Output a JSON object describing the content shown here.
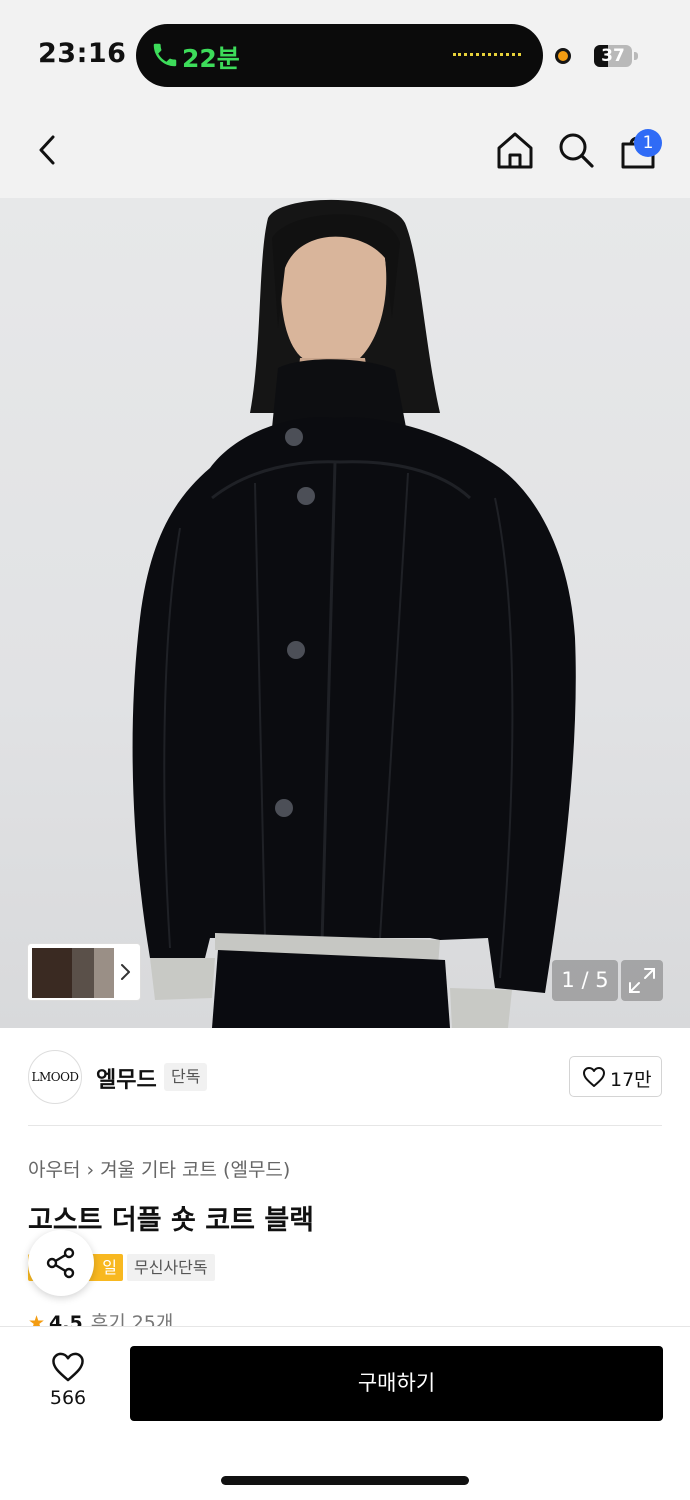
{
  "status_bar": {
    "time": "23:16",
    "call_duration": "22분",
    "battery_percent": "37",
    "battery_level": 0.37
  },
  "header": {
    "back_icon": "chevron-left-icon",
    "home_icon": "home-icon",
    "search_icon": "search-icon",
    "cart_icon": "shopping-bag-icon",
    "cart_count": "1"
  },
  "gallery": {
    "counter": "1 / 5",
    "thumbnail_chevron_icon": "chevron-right-icon",
    "expand_icon": "expand-icon"
  },
  "brand": {
    "logo_text": "LMOOD",
    "name": "엘무드",
    "tag": "단독",
    "like_count": "17만"
  },
  "product": {
    "breadcrumb": [
      "아우터",
      "겨울 기타 코트 (엘무드)"
    ],
    "title": "고스트 더플 숏 코트 블랙",
    "badge_sale": "일",
    "badge_exclusive": "무신사단독",
    "rating": "4.5",
    "review_label": "후기 25개"
  },
  "bottom_bar": {
    "wish_count": "566",
    "buy_label": "구매하기"
  },
  "colors": {
    "accent_blue": "#2f6bf6",
    "sale_yellow": "#f8b820",
    "call_green": "#3ddc5a",
    "star_orange": "#f39c12"
  }
}
